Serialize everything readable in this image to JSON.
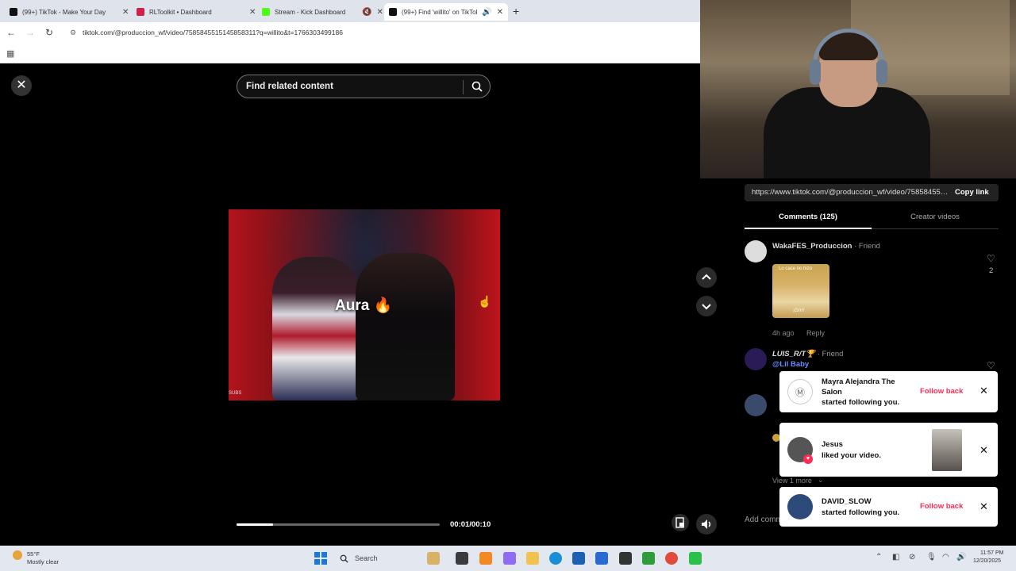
{
  "browser": {
    "tabs": [
      {
        "label": "(99+) TikTok - Make Your Day",
        "favicon_color": "#111111"
      },
      {
        "label": "RLToolkit • Dashboard",
        "favicon_color": "#d0204a"
      },
      {
        "label": "Stream - Kick Dashboard",
        "favicon_color": "#53fc18"
      },
      {
        "label": "(99+) Find 'willito' on TikTok",
        "favicon_color": "#111111"
      }
    ],
    "url": "tiktok.com/@produccion_wf/video/7585845515145858311?q=willito&t=1766303499186"
  },
  "viewer": {
    "search_placeholder": "Find related content",
    "video_caption": "Aura 🔥",
    "video_corner_text": "SUBS",
    "progress": 0.18,
    "time": "00:01/00:10"
  },
  "panel": {
    "link": "https://www.tiktok.com/@produccion_wf/video/7585845515145858311",
    "copy_link": "Copy link",
    "tab_comments": "Comments (125)",
    "tab_creator": "Creator videos",
    "comments": [
      {
        "name": "WakaFES_Produccion",
        "friend": " · Friend",
        "time": "4h ago",
        "reply": "Reply",
        "likes": "2",
        "sticker_top": "Lo cace no hizo",
        "sticker_bottom": "¡Grrr!"
      },
      {
        "name": "LUIS_R/T🏆",
        "friend": " · Friend",
        "mention": "@Lil Baby",
        "likes": ""
      }
    ],
    "view_more": "View 1 more",
    "add_comment": "Add comment..."
  },
  "notifications": [
    {
      "name": "Mayra Alejandra The Salon",
      "text": "started following you.",
      "action": "Follow back"
    },
    {
      "name": "Jesus",
      "text": "liked your video.",
      "action": ""
    },
    {
      "name": "DAVID_SLOW",
      "text": "started following you.",
      "action": "Follow back"
    }
  ],
  "taskbar": {
    "weather_temp": "55°F",
    "weather_desc": "Mostly clear",
    "search_label": "Search",
    "time": "11:57 PM",
    "date": "12/20/2025"
  },
  "colors": {
    "accent": "#fe2c55",
    "mention": "#6b8cff"
  }
}
